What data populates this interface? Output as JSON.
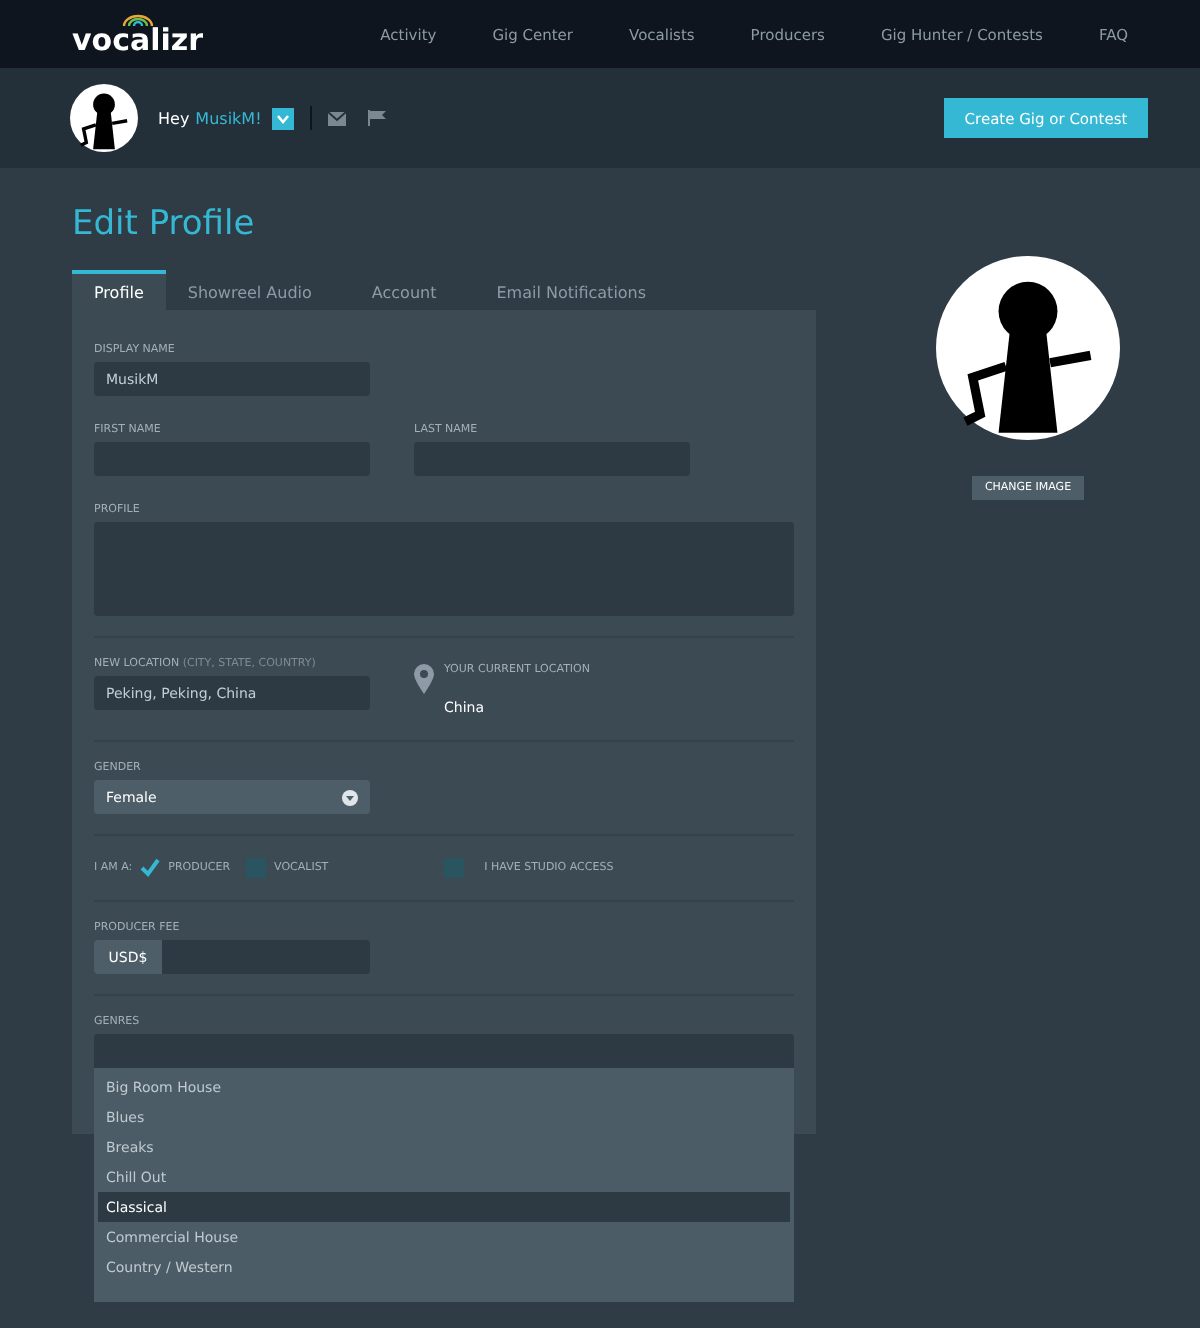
{
  "brand": "vocalizr",
  "nav": [
    "Activity",
    "Gig Center",
    "Vocalists",
    "Producers",
    "Gig Hunter / Contests",
    "FAQ"
  ],
  "user_bar": {
    "greeting": "Hey",
    "username": "MusikM!",
    "create_button": "Create Gig or Contest"
  },
  "title": "Edit Profile",
  "tabs": [
    {
      "label": "Profile",
      "selected": true
    },
    {
      "label": "Showreel Audio",
      "selected": false
    },
    {
      "label": "Account",
      "selected": false
    },
    {
      "label": "Email Notifications",
      "selected": false
    }
  ],
  "form": {
    "display_name": {
      "label": "DISPLAY NAME",
      "value": "MusikM"
    },
    "first_name": {
      "label": "FIRST NAME"
    },
    "last_name": {
      "label": "LAST NAME"
    },
    "profile": {
      "label": "PROFILE"
    },
    "new_location": {
      "label": "NEW LOCATION",
      "hint": "(CITY, STATE, COUNTRY)",
      "value": "Peking, Peking, China"
    },
    "current_location": {
      "label": "YOUR CURRENT LOCATION",
      "value": "China"
    },
    "gender": {
      "label": "GENDER",
      "value": "Female"
    },
    "i_am": {
      "label": "I AM A:",
      "roles": [
        {
          "label": "PRODUCER",
          "checked": true
        },
        {
          "label": "VOCALIST",
          "checked": false
        }
      ],
      "studio_access": {
        "label": "I HAVE STUDIO ACCESS",
        "checked": false
      }
    },
    "producer_fee": {
      "label": "PRODUCER FEE",
      "currency": "USD$"
    },
    "genres": {
      "label": "GENRES",
      "options": [
        {
          "label": "Big Room House",
          "selected": false
        },
        {
          "label": "Blues",
          "selected": false
        },
        {
          "label": "Breaks",
          "selected": false
        },
        {
          "label": "Chill Out",
          "selected": false
        },
        {
          "label": "Classical",
          "selected": true
        },
        {
          "label": "Commercial House",
          "selected": false
        },
        {
          "label": "Country / Western",
          "selected": false
        }
      ]
    }
  },
  "change_image": "CHANGE IMAGE"
}
